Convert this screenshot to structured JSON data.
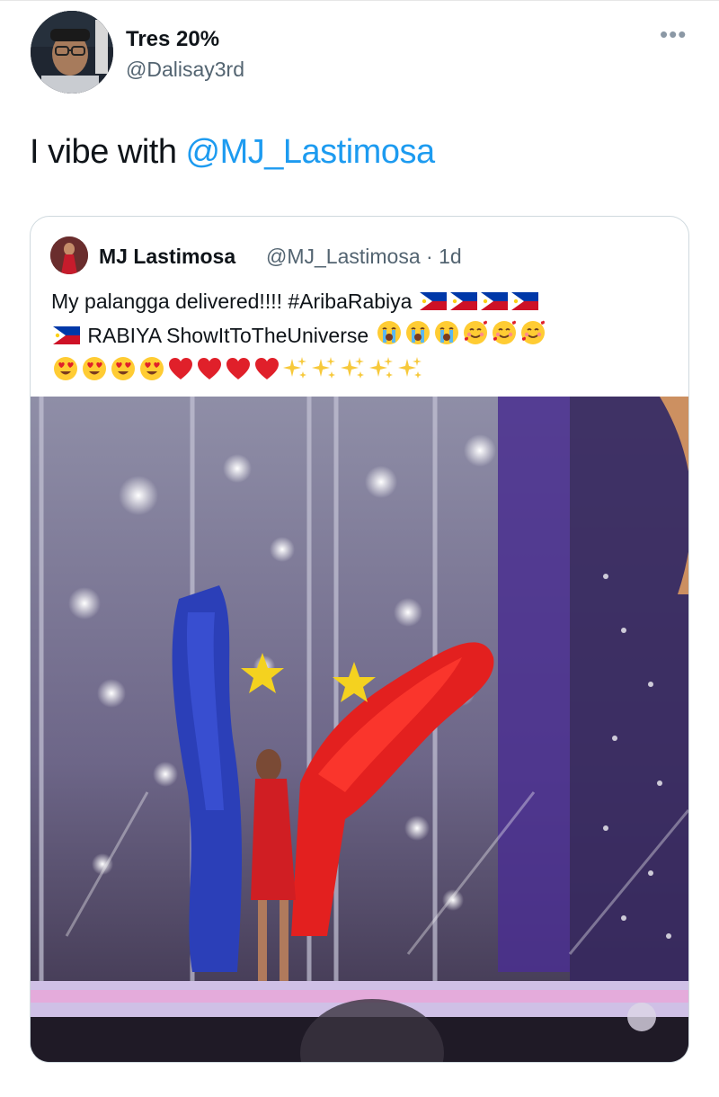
{
  "author": {
    "display_name": "Tres 20%",
    "handle": "@Dalisay3rd"
  },
  "tweet": {
    "text_plain": "I vibe with ",
    "mention": "@MJ_Lastimosa"
  },
  "more_menu_glyph": "•••",
  "quoted_tweet": {
    "display_name": "MJ Lastimosa",
    "handle": "@MJ_Lastimosa",
    "separator": " · ",
    "age": "1d",
    "text_line1": "My palangga delivered!!!! #AribaRabiya",
    "text_line2": "RABIYA ShowItToTheUniverse",
    "emoji_line2": [
      "loudly-crying",
      "loudly-crying",
      "loudly-crying",
      "smiling-hearts",
      "smiling-hearts",
      "smiling-hearts"
    ],
    "emoji_line3": [
      "heart-eyes",
      "heart-eyes",
      "heart-eyes",
      "heart-eyes",
      "red-heart",
      "red-heart",
      "red-heart",
      "red-heart",
      "sparkles",
      "sparkles",
      "sparkles",
      "sparkles",
      "sparkles"
    ],
    "flags_line1": 4,
    "flags_line2": 1,
    "media_description_icon": "stage-photo"
  },
  "colors": {
    "link": "#1d9bf0",
    "secondary_text": "#536471",
    "border": "#cfd9de"
  }
}
